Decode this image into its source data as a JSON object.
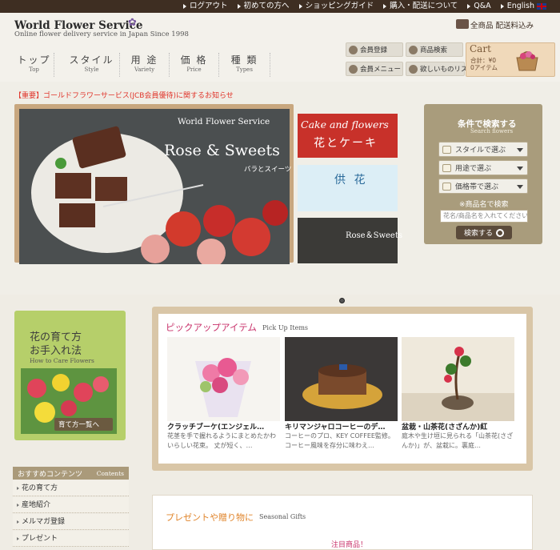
{
  "topbar": {
    "links": [
      {
        "label": "ログアウト"
      },
      {
        "label": "初めての方へ"
      },
      {
        "label": "ショッピングガイド"
      },
      {
        "label": "購入・配送について"
      },
      {
        "label": "Q&A"
      },
      {
        "label": "English"
      }
    ]
  },
  "header": {
    "logo_title": "World Flower Service",
    "logo_sub": "Online flower delivery service in Japan Since 1998",
    "shipping": "全商品 配送料込み"
  },
  "gnav": [
    {
      "jp": "トップ",
      "en": "Top"
    },
    {
      "jp": "スタイル",
      "en": "Style"
    },
    {
      "jp": "用 途",
      "en": "Variety"
    },
    {
      "jp": "価 格",
      "en": "Price"
    },
    {
      "jp": "種 類",
      "en": "Types"
    }
  ],
  "user_buttons": {
    "register": "会員登録",
    "product_search": "商品検索",
    "member_menu": "会員メニュー",
    "wishlist": "欲しいものリスト"
  },
  "cart": {
    "title": "Cart",
    "total": "合計：¥0",
    "items": "0アイテム"
  },
  "notice": "【重要】ゴールドフラワーサービス(JCB会員優待)に関するお知らせ",
  "hero": {
    "brand": "World Flower Service",
    "title": "Rose & Sweets",
    "subtitle": "バラとスイーツ"
  },
  "side_banners": {
    "b1_line1": "Cake and flowers",
    "b1_line2": "花とケーキ",
    "b2": "供 花",
    "b3": "Rose＆Sweets"
  },
  "search": {
    "title": "条件で検索する",
    "subtitle": "Search flowers",
    "style_select": "スタイルで選ぶ",
    "purpose_select": "用途で選ぶ",
    "price_select": "価格帯で選ぶ",
    "keyword_label": "※商品名で検索",
    "keyword_placeholder": "花名/商品名を入れてください",
    "button": "検索する"
  },
  "care": {
    "line1": "花の育て方",
    "line2": "お手入れ法",
    "en": "How to Care Flowers",
    "button": "育て方一覧へ"
  },
  "contents": {
    "title": "おすすめコンテンツ",
    "title_en": "Contents",
    "items": [
      "花の育て方",
      "産地紹介",
      "メルマガ登録",
      "プレゼント"
    ]
  },
  "pickup": {
    "title": "ピックアップアイテム",
    "title_en": "Pick Up Items",
    "items": [
      {
        "name": "クラッチブーケ(エンジェル…",
        "desc": "花茎を手で握れるようにまとめたかわいらしい花束。 丈が短く、…"
      },
      {
        "name": "キリマンジャロコーヒーのデ…",
        "desc": "コーヒーのプロ、KEY COFFEE監修。コーヒー風味を存分に味わえ…"
      },
      {
        "name": "盆栽・山茶花(さざんか)紅",
        "desc": "庭木や生け垣に見られる「山茶花(さざんか)」が、盆栽に。裏庭…"
      }
    ]
  },
  "gifts": {
    "title": "プレゼントや贈り物に",
    "title_en": "Seasonal Gifts",
    "badge": "注目商品！"
  },
  "colors": {
    "topbar": "#3e2e22",
    "accent_pink": "#c8316a",
    "notice_red": "#e0342a",
    "search_panel": "#a99c7c",
    "care_green": "#b6cf6a"
  }
}
